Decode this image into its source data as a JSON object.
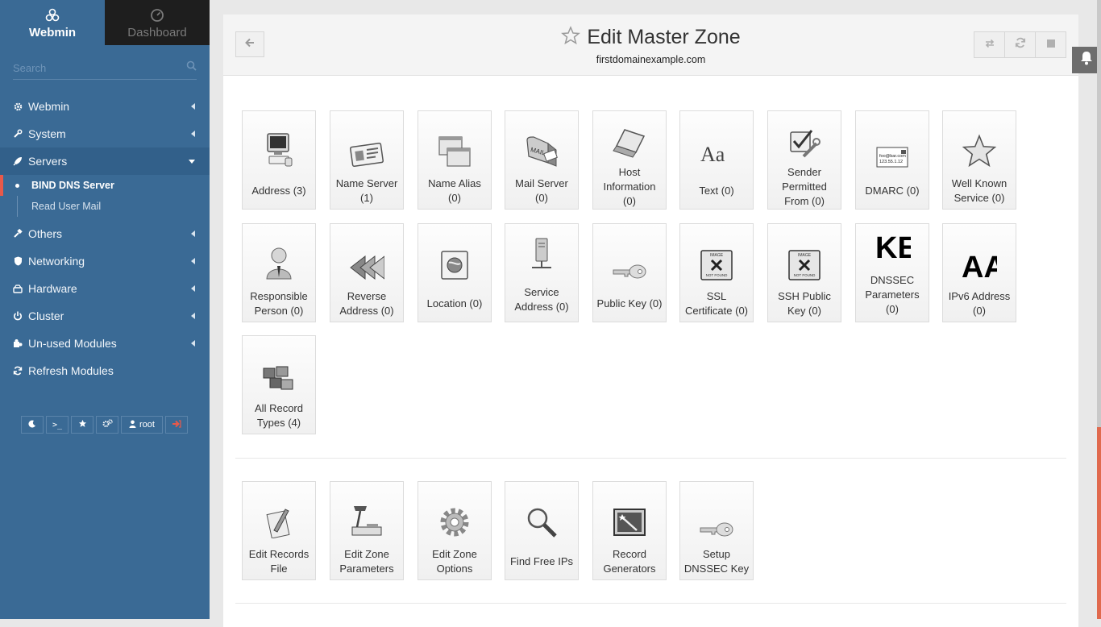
{
  "sidebar": {
    "tabs": [
      {
        "label": "Webmin",
        "icon": "webmin-logo-icon"
      },
      {
        "label": "Dashboard",
        "icon": "dashboard-icon"
      }
    ],
    "search_placeholder": "Search",
    "nav": [
      {
        "label": "Webmin",
        "icon": "gear-icon"
      },
      {
        "label": "System",
        "icon": "wrench-icon"
      },
      {
        "label": "Servers",
        "icon": "rocket-icon"
      },
      {
        "label": "Others",
        "icon": "wrench-icon"
      },
      {
        "label": "Networking",
        "icon": "shield-icon"
      },
      {
        "label": "Hardware",
        "icon": "hdd-icon"
      },
      {
        "label": "Cluster",
        "icon": "power-icon"
      },
      {
        "label": "Un-used Modules",
        "icon": "puzzle-icon"
      },
      {
        "label": "Refresh Modules",
        "icon": "refresh-icon"
      }
    ],
    "servers_sub": [
      {
        "label": "BIND DNS Server"
      },
      {
        "label": "Read User Mail"
      }
    ],
    "bottom": {
      "user_label": "root"
    }
  },
  "header": {
    "title": "Edit Master Zone",
    "subtitle": "firstdomainexample.com"
  },
  "record_tiles": [
    {
      "label": "Address (3)",
      "icon": "computer-icon"
    },
    {
      "label": "Name Server (1)",
      "icon": "id-card-icon"
    },
    {
      "label": "Name Alias (0)",
      "icon": "windows-icon"
    },
    {
      "label": "Mail Server (0)",
      "icon": "mailbox-icon"
    },
    {
      "label": "Host Information (0)",
      "icon": "laptop-icon"
    },
    {
      "label": "Text (0)",
      "icon": "text-aa-icon"
    },
    {
      "label": "Sender Permitted From (0)",
      "icon": "check-wrench-icon"
    },
    {
      "label": "DMARC (0)",
      "icon": "dmarc-card-icon"
    },
    {
      "label": "Well Known Service (0)",
      "icon": "star-icon"
    },
    {
      "label": "Responsible Person (0)",
      "icon": "person-icon"
    },
    {
      "label": "Reverse Address (0)",
      "icon": "rewind-icon"
    },
    {
      "label": "Location (0)",
      "icon": "globe-icon"
    },
    {
      "label": "Service Address (0)",
      "icon": "server-tower-icon"
    },
    {
      "label": "Public Key (0)",
      "icon": "key-icon"
    },
    {
      "label": "SSL Certificate (0)",
      "icon": "image-not-found-icon"
    },
    {
      "label": "SSH Public Key (0)",
      "icon": "image-not-found-icon"
    },
    {
      "label": "DNSSEC Parameters (0)",
      "icon": "ke-text-icon"
    },
    {
      "label": "IPv6 Address (0)",
      "icon": "aaaa-text-icon"
    },
    {
      "label": "All Record Types (4)",
      "icon": "cubes-icon"
    }
  ],
  "action_tiles": [
    {
      "label": "Edit Records File",
      "icon": "pen-paper-icon"
    },
    {
      "label": "Edit Zone Parameters",
      "icon": "desk-lamp-icon"
    },
    {
      "label": "Edit Zone Options",
      "icon": "cog-icon"
    },
    {
      "label": "Find Free IPs",
      "icon": "magnifier-icon"
    },
    {
      "label": "Record Generators",
      "icon": "magic-screen-icon"
    },
    {
      "label": "Setup DNSSEC Key",
      "icon": "key-icon"
    }
  ],
  "image_text": {
    "not_found_top": "IMAGE",
    "not_found_bottom": "NOT FOUND",
    "dmarc_line1": "foo@bar.com",
    "dmarc_line2": "123.55.1.12",
    "ke": "KE",
    "aaaa": "AA",
    "aa": "Aa",
    "mail": "MAIL"
  }
}
